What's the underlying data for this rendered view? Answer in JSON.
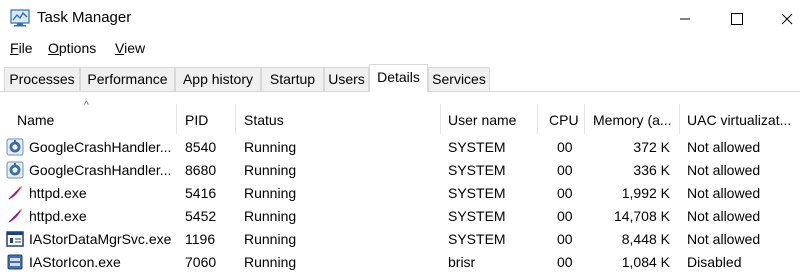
{
  "window": {
    "title": "Task Manager",
    "icon": "task-manager-icon"
  },
  "menu": [
    {
      "label": "File",
      "accel": "F",
      "rest": "ile"
    },
    {
      "label": "Options",
      "accel": "O",
      "rest": "ptions"
    },
    {
      "label": "View",
      "accel": "V",
      "rest": "iew"
    }
  ],
  "tabs": [
    {
      "label": "Processes",
      "active": false
    },
    {
      "label": "Performance",
      "active": false
    },
    {
      "label": "App history",
      "active": false
    },
    {
      "label": "Startup",
      "active": false
    },
    {
      "label": "Users",
      "active": false
    },
    {
      "label": "Details",
      "active": true
    },
    {
      "label": "Services",
      "active": false
    }
  ],
  "table": {
    "sort_indicator": "^",
    "columns": [
      "Name",
      "PID",
      "Status",
      "User name",
      "CPU",
      "Memory (a...",
      "UAC virtualizat..."
    ],
    "rows": [
      {
        "icon": "google-crash-handler-icon",
        "name": "GoogleCrashHandler...",
        "pid": "8540",
        "status": "Running",
        "user": "SYSTEM",
        "cpu": "00",
        "memory": "372 K",
        "uac": "Not allowed"
      },
      {
        "icon": "google-crash-handler-icon",
        "name": "GoogleCrashHandler...",
        "pid": "8680",
        "status": "Running",
        "user": "SYSTEM",
        "cpu": "00",
        "memory": "336 K",
        "uac": "Not allowed"
      },
      {
        "icon": "apache-feather-icon",
        "name": "httpd.exe",
        "pid": "5416",
        "status": "Running",
        "user": "SYSTEM",
        "cpu": "00",
        "memory": "1,992 K",
        "uac": "Not allowed"
      },
      {
        "icon": "apache-feather-icon",
        "name": "httpd.exe",
        "pid": "5452",
        "status": "Running",
        "user": "SYSTEM",
        "cpu": "00",
        "memory": "14,708 K",
        "uac": "Not allowed"
      },
      {
        "icon": "service-window-icon",
        "name": "IAStorDataMgrSvc.exe",
        "pid": "1196",
        "status": "Running",
        "user": "SYSTEM",
        "cpu": "00",
        "memory": "8,448 K",
        "uac": "Not allowed"
      },
      {
        "icon": "storage-drive-icon",
        "name": "IAStorIcon.exe",
        "pid": "7060",
        "status": "Running",
        "user": "brisr",
        "cpu": "00",
        "memory": "1,084 K",
        "uac": "Disabled"
      }
    ]
  }
}
